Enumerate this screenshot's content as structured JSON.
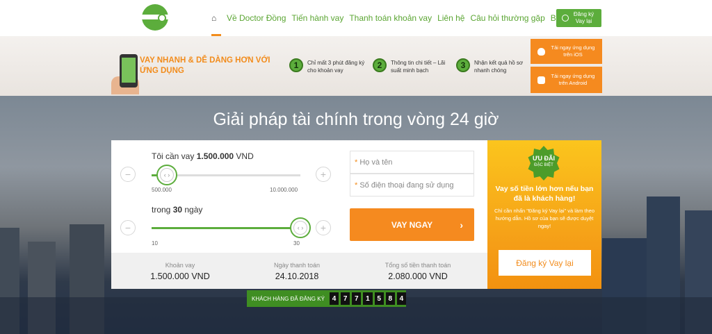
{
  "header": {
    "nav": [
      "Về Doctor Đồng",
      "Tiến hành vay",
      "Thanh toán khoản vay",
      "Liên hệ",
      "Câu hỏi thường gặp",
      "Blog"
    ],
    "register_button": "Đăng ký Vay lại"
  },
  "banner": {
    "title": "VAY NHANH & DỄ DÀNG HƠN VỚI ỨNG DỤNG",
    "steps": [
      {
        "num": "1",
        "text": "Chỉ mất 3 phút đăng ký cho khoản vay"
      },
      {
        "num": "2",
        "text": "Thông tin chi tiết – Lãi suất minh bạch"
      },
      {
        "num": "3",
        "text": "Nhận kết quả hồ sơ nhanh chóng"
      }
    ],
    "ios_button": "Tải ngay ứng dụng trên iOS",
    "android_button": "Tải ngay ứng dụng trên Android"
  },
  "hero": {
    "title": "Giải pháp tài chính trong vòng 24 giờ"
  },
  "loan_form": {
    "amount_prefix": "Tôi cần vay ",
    "amount_value": "1.500.000",
    "amount_suffix": " VND",
    "amount_min": "500.000",
    "amount_max": "10.000.000",
    "amount_fraction": 0.105,
    "term_prefix": "trong ",
    "term_value": "30",
    "term_suffix": " ngày",
    "term_min": "10",
    "term_max": "30",
    "term_fraction": 1.0,
    "name_placeholder": "Họ và tên",
    "phone_placeholder": "Số điện thoại đang sử dụng",
    "required_mark": "*",
    "submit": "VAY NGAY"
  },
  "summary": [
    {
      "label": "Khoản vay",
      "value": "1.500.000 VND"
    },
    {
      "label": "Ngày thanh toán",
      "value": "24.10.2018"
    },
    {
      "label": "Tổng số tiền thanh toán",
      "value": "2.080.000 VND"
    }
  ],
  "promo": {
    "badge_line1": "ƯU ĐÃI",
    "badge_line2": "ĐẶC BIỆT",
    "title": "Vay số tiền lớn hơn nếu bạn đã là khách hàng!",
    "description": "Chỉ cần nhấn \"Đăng ký Vay lại\" và làm theo hướng dẫn. Hồ sơ của bạn sẽ được duyệt ngay!",
    "button": "Đăng ký Vay lại"
  },
  "counter": {
    "label": "KHÁCH HÀNG ĐÃ ĐĂNG KÝ",
    "digits": [
      "4",
      "7",
      "7",
      "1",
      "5",
      "8",
      "4"
    ]
  },
  "colors": {
    "brand_green": "#5cad3c",
    "accent_orange": "#f58a1f"
  }
}
